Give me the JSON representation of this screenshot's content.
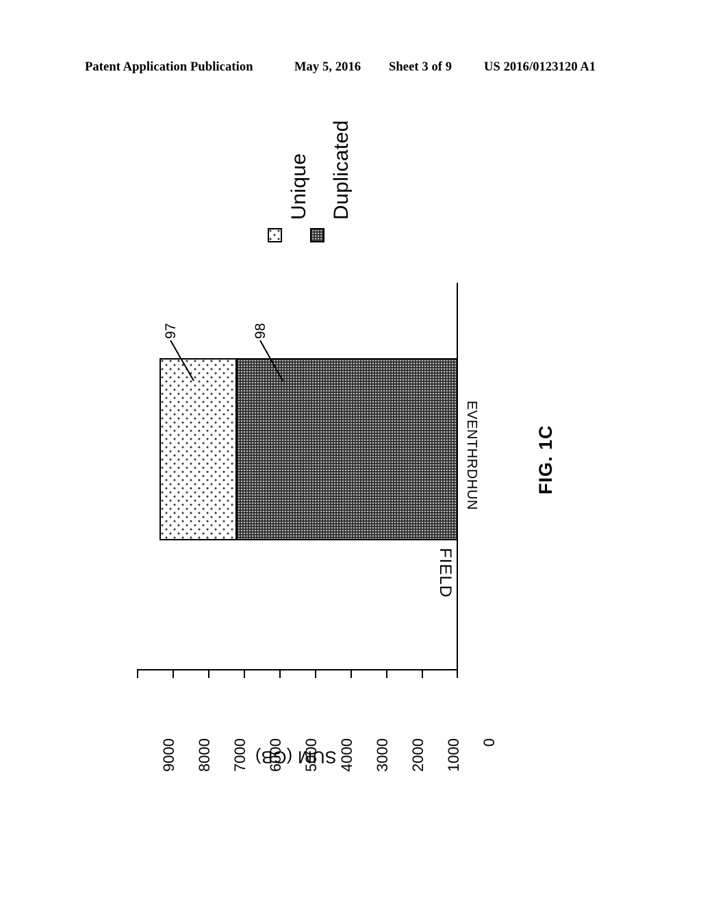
{
  "header": {
    "publication": "Patent Application Publication",
    "date": "May 5, 2016",
    "sheet": "Sheet 3 of 9",
    "number": "US 2016/0123120 A1"
  },
  "figure": {
    "caption": "FIG. 1C",
    "reference_numerals": [
      {
        "id": "97",
        "points_to": "Unique"
      },
      {
        "id": "98",
        "points_to": "Duplicated"
      }
    ]
  },
  "legend": {
    "position": "top-right",
    "items": [
      {
        "label": "Unique",
        "swatch": "sparse-dot-pattern-swatch"
      },
      {
        "label": "Duplicated",
        "swatch": "dense-checker-pattern-swatch"
      }
    ]
  },
  "chart_data": {
    "type": "bar",
    "orientation": "horizontal",
    "stacked": true,
    "title": "FIG. 1C",
    "xlabel": "FIELD",
    "ylabel": "SUM (GB)",
    "categories": [
      "EVENTHRDHUN"
    ],
    "series": [
      {
        "name": "Unique",
        "values": [
          2150
        ]
      },
      {
        "name": "Duplicated",
        "values": [
          6210
        ]
      }
    ],
    "totals": [
      8360
    ],
    "ylim": [
      0,
      9000
    ],
    "yticks": [
      9000,
      8000,
      7000,
      6000,
      5000,
      4000,
      3000,
      2000,
      1000,
      0
    ],
    "ytick_labels": [
      "9000",
      "8000",
      "7000",
      "6000",
      "5000",
      "4000",
      "3000",
      "2000",
      "1000",
      "0"
    ],
    "grid": false,
    "legend_position": "top-right",
    "annotations": [
      {
        "text": "97",
        "target": "Unique segment"
      },
      {
        "text": "98",
        "target": "Duplicated segment"
      }
    ]
  }
}
